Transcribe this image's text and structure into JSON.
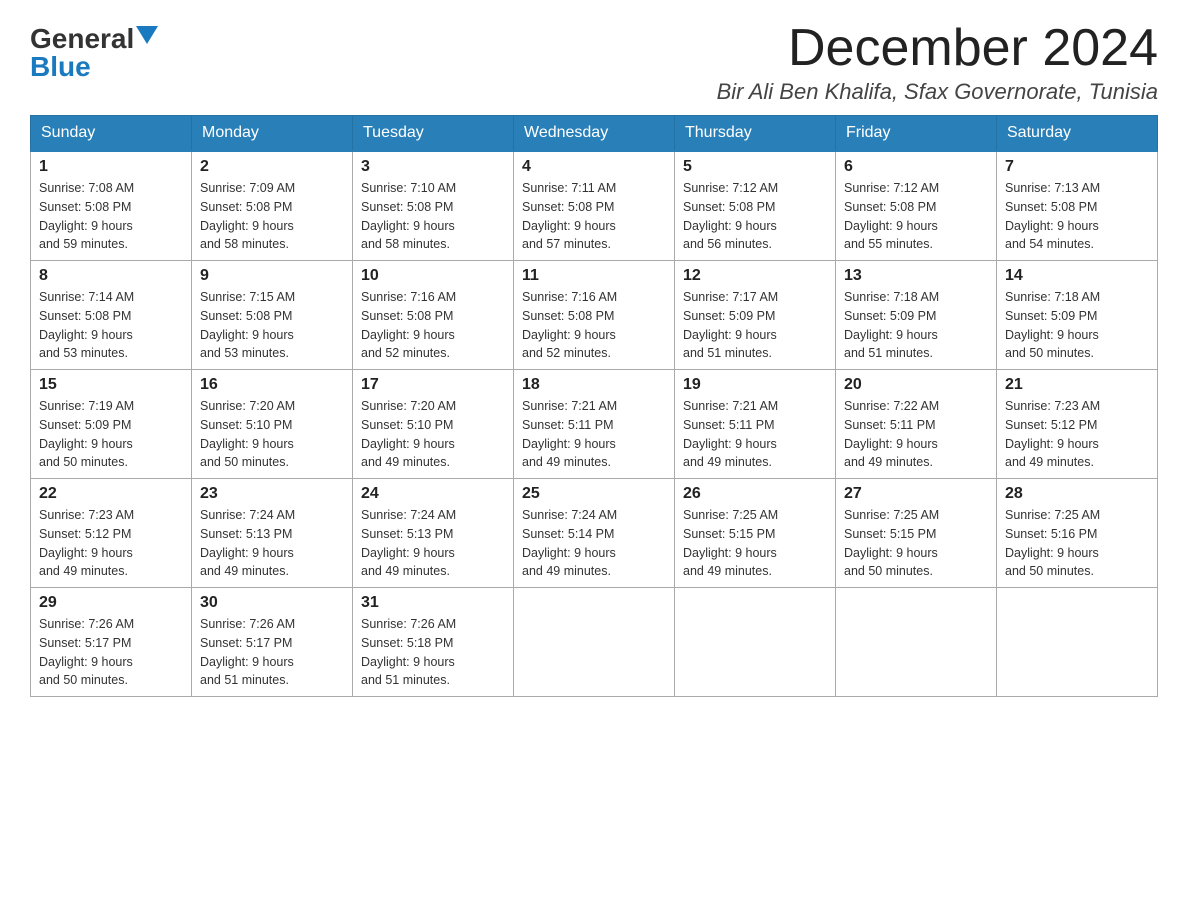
{
  "logo": {
    "general": "General",
    "blue": "Blue"
  },
  "title": {
    "month_year": "December 2024",
    "location": "Bir Ali Ben Khalifa, Sfax Governorate, Tunisia"
  },
  "headers": [
    "Sunday",
    "Monday",
    "Tuesday",
    "Wednesday",
    "Thursday",
    "Friday",
    "Saturday"
  ],
  "weeks": [
    [
      {
        "day": "1",
        "sunrise": "7:08 AM",
        "sunset": "5:08 PM",
        "daylight": "9 hours and 59 minutes."
      },
      {
        "day": "2",
        "sunrise": "7:09 AM",
        "sunset": "5:08 PM",
        "daylight": "9 hours and 58 minutes."
      },
      {
        "day": "3",
        "sunrise": "7:10 AM",
        "sunset": "5:08 PM",
        "daylight": "9 hours and 58 minutes."
      },
      {
        "day": "4",
        "sunrise": "7:11 AM",
        "sunset": "5:08 PM",
        "daylight": "9 hours and 57 minutes."
      },
      {
        "day": "5",
        "sunrise": "7:12 AM",
        "sunset": "5:08 PM",
        "daylight": "9 hours and 56 minutes."
      },
      {
        "day": "6",
        "sunrise": "7:12 AM",
        "sunset": "5:08 PM",
        "daylight": "9 hours and 55 minutes."
      },
      {
        "day": "7",
        "sunrise": "7:13 AM",
        "sunset": "5:08 PM",
        "daylight": "9 hours and 54 minutes."
      }
    ],
    [
      {
        "day": "8",
        "sunrise": "7:14 AM",
        "sunset": "5:08 PM",
        "daylight": "9 hours and 53 minutes."
      },
      {
        "day": "9",
        "sunrise": "7:15 AM",
        "sunset": "5:08 PM",
        "daylight": "9 hours and 53 minutes."
      },
      {
        "day": "10",
        "sunrise": "7:16 AM",
        "sunset": "5:08 PM",
        "daylight": "9 hours and 52 minutes."
      },
      {
        "day": "11",
        "sunrise": "7:16 AM",
        "sunset": "5:08 PM",
        "daylight": "9 hours and 52 minutes."
      },
      {
        "day": "12",
        "sunrise": "7:17 AM",
        "sunset": "5:09 PM",
        "daylight": "9 hours and 51 minutes."
      },
      {
        "day": "13",
        "sunrise": "7:18 AM",
        "sunset": "5:09 PM",
        "daylight": "9 hours and 51 minutes."
      },
      {
        "day": "14",
        "sunrise": "7:18 AM",
        "sunset": "5:09 PM",
        "daylight": "9 hours and 50 minutes."
      }
    ],
    [
      {
        "day": "15",
        "sunrise": "7:19 AM",
        "sunset": "5:09 PM",
        "daylight": "9 hours and 50 minutes."
      },
      {
        "day": "16",
        "sunrise": "7:20 AM",
        "sunset": "5:10 PM",
        "daylight": "9 hours and 50 minutes."
      },
      {
        "day": "17",
        "sunrise": "7:20 AM",
        "sunset": "5:10 PM",
        "daylight": "9 hours and 49 minutes."
      },
      {
        "day": "18",
        "sunrise": "7:21 AM",
        "sunset": "5:11 PM",
        "daylight": "9 hours and 49 minutes."
      },
      {
        "day": "19",
        "sunrise": "7:21 AM",
        "sunset": "5:11 PM",
        "daylight": "9 hours and 49 minutes."
      },
      {
        "day": "20",
        "sunrise": "7:22 AM",
        "sunset": "5:11 PM",
        "daylight": "9 hours and 49 minutes."
      },
      {
        "day": "21",
        "sunrise": "7:23 AM",
        "sunset": "5:12 PM",
        "daylight": "9 hours and 49 minutes."
      }
    ],
    [
      {
        "day": "22",
        "sunrise": "7:23 AM",
        "sunset": "5:12 PM",
        "daylight": "9 hours and 49 minutes."
      },
      {
        "day": "23",
        "sunrise": "7:24 AM",
        "sunset": "5:13 PM",
        "daylight": "9 hours and 49 minutes."
      },
      {
        "day": "24",
        "sunrise": "7:24 AM",
        "sunset": "5:13 PM",
        "daylight": "9 hours and 49 minutes."
      },
      {
        "day": "25",
        "sunrise": "7:24 AM",
        "sunset": "5:14 PM",
        "daylight": "9 hours and 49 minutes."
      },
      {
        "day": "26",
        "sunrise": "7:25 AM",
        "sunset": "5:15 PM",
        "daylight": "9 hours and 49 minutes."
      },
      {
        "day": "27",
        "sunrise": "7:25 AM",
        "sunset": "5:15 PM",
        "daylight": "9 hours and 50 minutes."
      },
      {
        "day": "28",
        "sunrise": "7:25 AM",
        "sunset": "5:16 PM",
        "daylight": "9 hours and 50 minutes."
      }
    ],
    [
      {
        "day": "29",
        "sunrise": "7:26 AM",
        "sunset": "5:17 PM",
        "daylight": "9 hours and 50 minutes."
      },
      {
        "day": "30",
        "sunrise": "7:26 AM",
        "sunset": "5:17 PM",
        "daylight": "9 hours and 51 minutes."
      },
      {
        "day": "31",
        "sunrise": "7:26 AM",
        "sunset": "5:18 PM",
        "daylight": "9 hours and 51 minutes."
      },
      null,
      null,
      null,
      null
    ]
  ],
  "labels": {
    "sunrise": "Sunrise:",
    "sunset": "Sunset:",
    "daylight": "Daylight:"
  }
}
